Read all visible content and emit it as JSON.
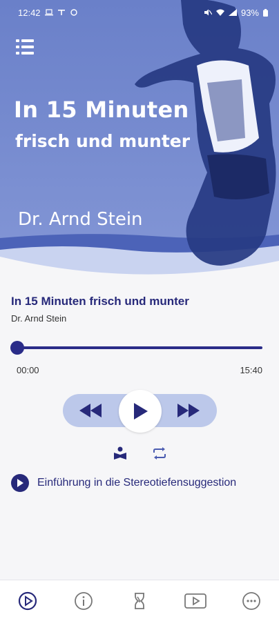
{
  "status_bar": {
    "time": "12:42",
    "battery": "93%"
  },
  "hero": {
    "title": "In 15 Minuten",
    "subtitle": "frisch und munter",
    "author": "Dr. Arnd Stein"
  },
  "track": {
    "title": "In 15 Minuten frisch und munter",
    "author": "Dr. Arnd Stein"
  },
  "player": {
    "current_time": "00:00",
    "total_time": "15:40",
    "progress": 0
  },
  "chapter": {
    "label": "Einführung in die Stereotiefensuggestion"
  },
  "bottom_nav": {
    "items": [
      "player-icon",
      "info-icon",
      "history-icon",
      "video-icon",
      "more-icon"
    ]
  },
  "colors": {
    "primary": "#27297a",
    "hero_tint": "#6f85cc",
    "pill": "#bcc8ea"
  }
}
